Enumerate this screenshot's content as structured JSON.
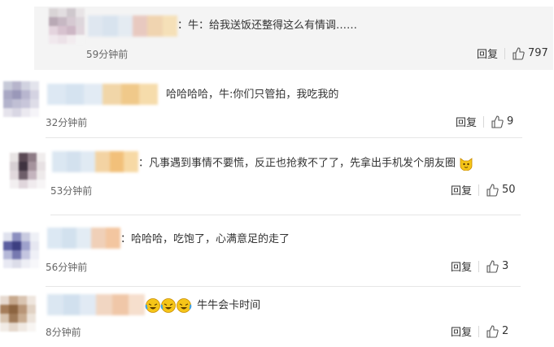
{
  "comments": [
    {
      "text": "：牛：给我送饭还整得这么有情调……",
      "time": "59分钟前",
      "reply": "回复",
      "likes": "797"
    },
    {
      "text": "哈哈哈哈，牛:你们只管拍，我吃我的",
      "time": "32分钟前",
      "reply": "回复",
      "likes": "9"
    },
    {
      "text": "：凡事遇到事情不要慌，反正也抢救不了了，先拿出手机发个朋友圈",
      "time": "53分钟前",
      "reply": "回复",
      "likes": "50"
    },
    {
      "text": "：哈哈哈，吃饱了，心满意足的走了",
      "time": "56分钟前",
      "reply": "回复",
      "likes": "3"
    },
    {
      "text": "牛牛会卡时间",
      "time": "8分钟前",
      "reply": "回复",
      "likes": "2"
    }
  ],
  "icons": {
    "like": "thumbs-up-icon",
    "emoji_cat": "cat-face-emoji",
    "emoji_laugh": "laughing-crying-emoji"
  },
  "colors": {
    "first_card_bg": "#f4f4f4",
    "text": "#333333",
    "meta": "#666666",
    "emoji_yellow": "#f5c518"
  }
}
